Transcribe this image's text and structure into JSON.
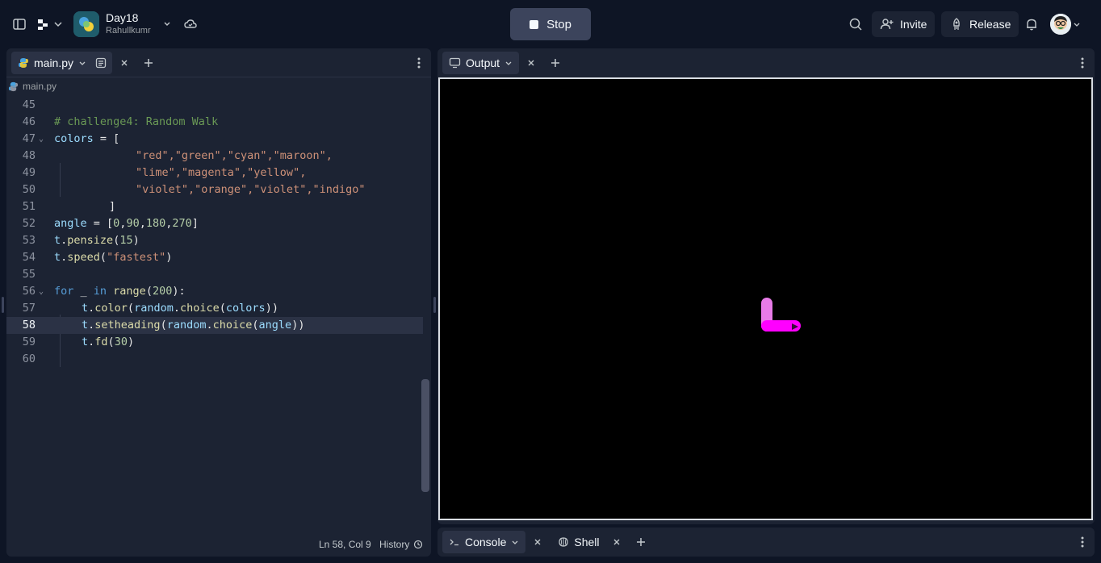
{
  "header": {
    "repl_name": "Day18",
    "repl_owner": "Rahullkumr",
    "stop_label": "Stop",
    "invite_label": "Invite",
    "release_label": "Release"
  },
  "editor": {
    "tab_label": "main.py",
    "breadcrumb": "main.py",
    "lines": [
      {
        "n": "45"
      },
      {
        "n": "46"
      },
      {
        "n": "47"
      },
      {
        "n": "48"
      },
      {
        "n": "49"
      },
      {
        "n": "50"
      },
      {
        "n": "51"
      },
      {
        "n": "52"
      },
      {
        "n": "53"
      },
      {
        "n": "54"
      },
      {
        "n": "55"
      },
      {
        "n": "56"
      },
      {
        "n": "57"
      },
      {
        "n": "58"
      },
      {
        "n": "59"
      },
      {
        "n": "60"
      }
    ],
    "code": {
      "l46": "# challenge4: Random Walk",
      "l47_a": "colors",
      "l47_b": " = [",
      "l48": "\"red\",\"green\",\"cyan\",\"maroon\",",
      "l49": "\"lime\",\"magenta\",\"yellow\",",
      "l50": "\"violet\",\"orange\",\"violet\",\"indigo\"",
      "l51": "]",
      "l52_a": "angle",
      "l52_b": " = [",
      "l52_n1": "0",
      "l52_n2": "90",
      "l52_n3": "180",
      "l52_n4": "270",
      "l52_c": "]",
      "l53_a": "t",
      "l53_b": ".",
      "l53_fn": "pensize",
      "l53_num": "15",
      "l54_a": "t",
      "l54_fn": "speed",
      "l54_str": "\"fastest\"",
      "l56_kw1": "for",
      "l56_var": " _ ",
      "l56_kw2": "in",
      "l56_fn": " range",
      "l56_num": "200",
      "l57_a": "t",
      "l57_fn": "color",
      "l57_fn2": "random",
      "l57_fn3": "choice",
      "l57_var": "colors",
      "l58_a": "t",
      "l58_fn": "setheading",
      "l58_fn2": "random",
      "l58_fn3": "choice",
      "l58_var": "angle",
      "l59_a": "t",
      "l59_fn": "fd",
      "l59_num": "30"
    },
    "status_position": "Ln 58, Col 9",
    "status_history": "History"
  },
  "output": {
    "tab_label": "Output",
    "turtle_path_colors": [
      "#e87be8",
      "#ff00ff"
    ]
  },
  "bottom": {
    "console_label": "Console",
    "shell_label": "Shell"
  }
}
